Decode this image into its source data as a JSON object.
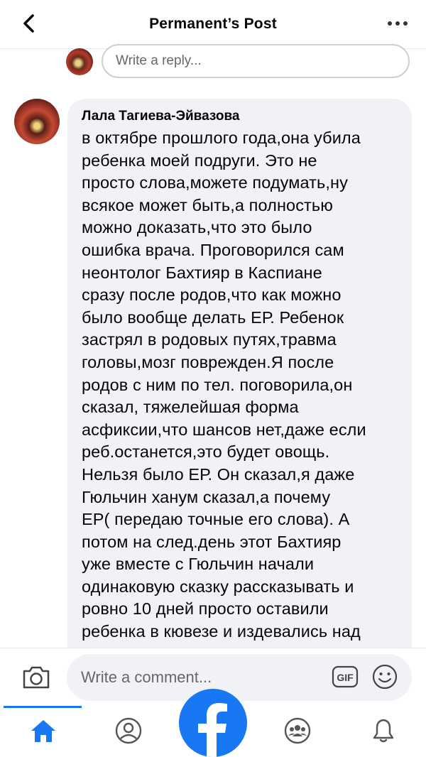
{
  "header": {
    "title": "Permanent’s Post"
  },
  "reply": {
    "placeholder": "Write a reply..."
  },
  "comment": {
    "author": "Лала Тагиева-Эйвазова",
    "text": "в октябре прошлого года,она убила\nребенка моей подруги. Это не\nпросто слова,можете подумать,ну\nвсякое может быть,а полностью\nможно доказать,что это было\nошибка врача. Проговорился сам\nнеонтолог Бахтияр в Каспиане\nсразу после родов,что как можно\nбыло вообще делать ЕР. Ребенок\nзастрял в родовых путях,травма\nголовы,мозг поврежден.Я после\nродов с ним по тел. поговорила,он\nсказал, тяжелейшая форма\nасфиксии,что шансов нет,даже если\nреб.останется,это будет овощь.\nНельзя было ЕР. Он сказал,я даже\nГюльчин ханум сказал,а почему\nЕР( передаю точные его слова). А\nпотом на след.день этот Бахтияр\nуже вместе с Гюльчин  начали\nодинаковую сказку рассказывать и\nровно 10 дней просто оставили\nребенка в кювезе и издевались над"
  },
  "composer": {
    "placeholder": "Write a comment...",
    "gif_label": "GIF"
  },
  "tabs": [
    {
      "icon": "home-icon",
      "active": true
    },
    {
      "icon": "profile-icon",
      "active": false
    },
    {
      "icon": "groups-icon",
      "active": false
    },
    {
      "icon": "notifications-icon",
      "active": false
    }
  ],
  "colors": {
    "accent": "#1877f2",
    "bubble": "#f0f2f5",
    "text": "#050505",
    "muted": "#65676b"
  }
}
